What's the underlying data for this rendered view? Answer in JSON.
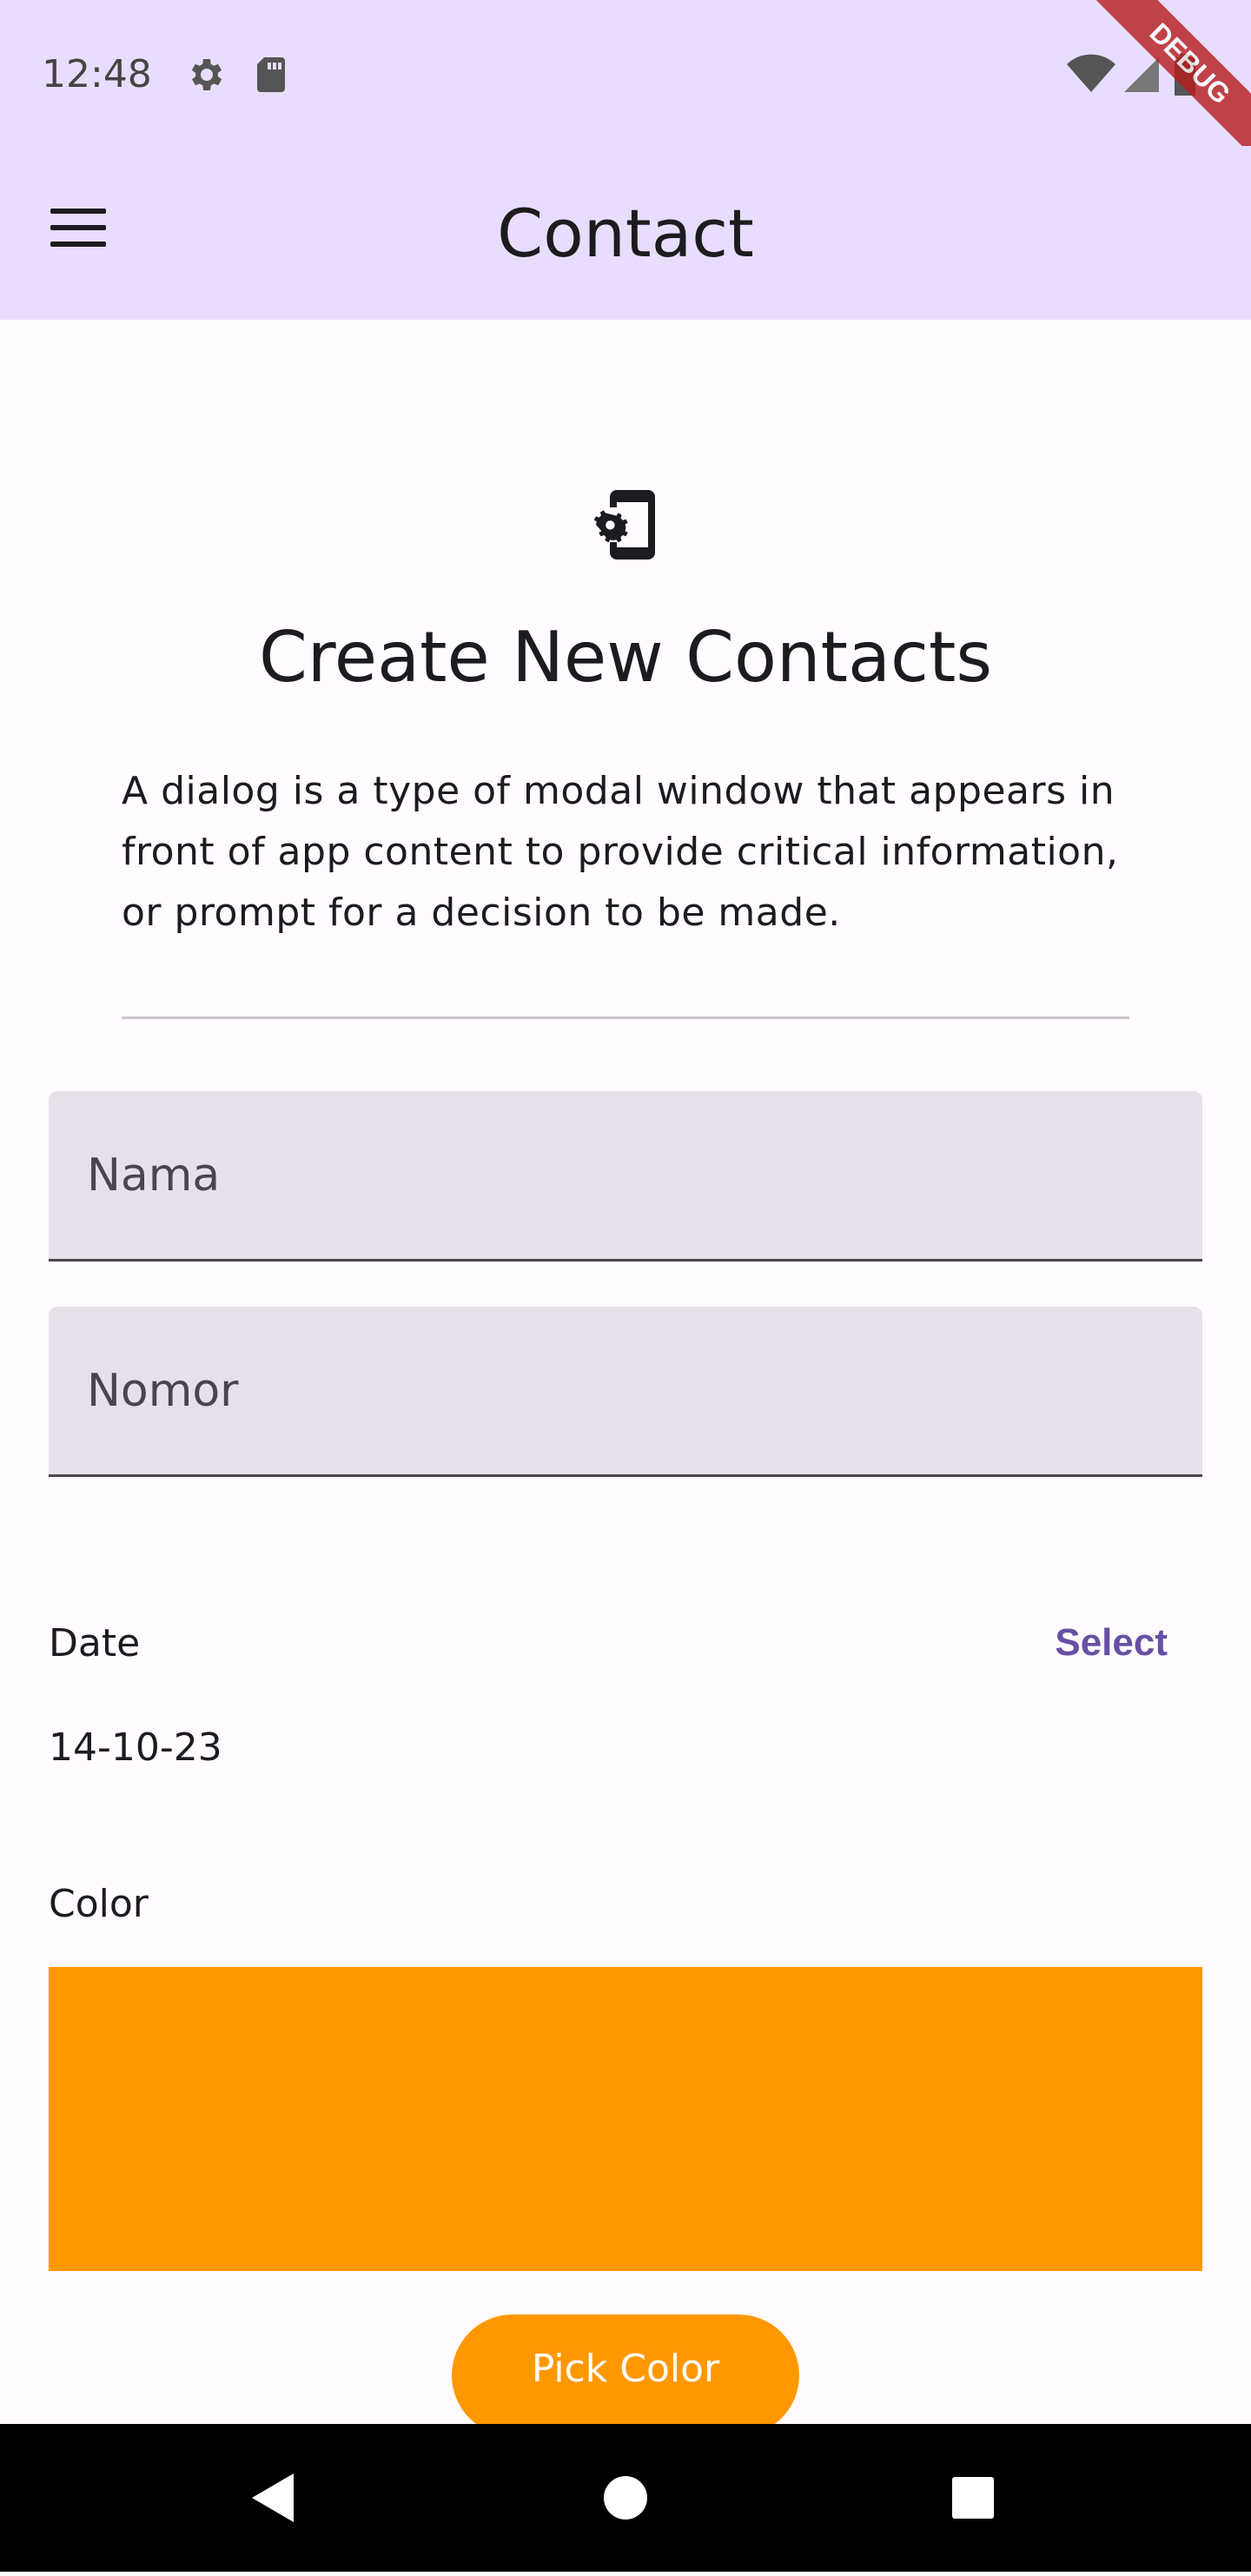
{
  "status_bar": {
    "time": "12:48",
    "icons": [
      "gear-icon",
      "sd-card-icon",
      "wifi-icon",
      "signal-icon",
      "battery-icon"
    ]
  },
  "debug_banner": "DEBUG",
  "app_bar": {
    "title": "Contact",
    "menu_icon": "menu-icon"
  },
  "hero": {
    "icon": "phone-settings-icon",
    "heading": "Create New Contacts",
    "description": "A dialog is a type of modal window that appears in front of app content to provide critical information, or prompt for a decision to be made."
  },
  "form": {
    "name_placeholder": "Nama",
    "number_placeholder": "Nomor"
  },
  "date": {
    "label": "Date",
    "select_label": "Select",
    "value": "14-10-23"
  },
  "color": {
    "label": "Color",
    "selected": "#ff9800",
    "pick_label": "Pick Color"
  },
  "nav_bar": {
    "buttons": [
      "back-icon",
      "home-icon",
      "recents-icon"
    ]
  },
  "colors": {
    "app_bar": "#e9ddff",
    "accent": "#6750a4",
    "field_bg": "#e6e0e9"
  }
}
